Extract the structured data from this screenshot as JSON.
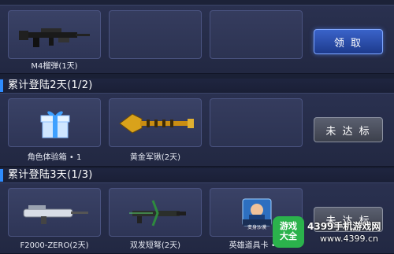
{
  "rows": [
    {
      "header": "",
      "items": [
        {
          "label": "M4榴弹(1天)",
          "icon": "rifle-icon"
        },
        {
          "label": "",
          "icon": ""
        },
        {
          "label": "",
          "icon": ""
        }
      ],
      "button": {
        "label": "领 取",
        "state": "claimable"
      }
    },
    {
      "header": "累计登陆2天(1/2)",
      "items": [
        {
          "label": "角色体验箱 • 1",
          "icon": "gift-box-icon"
        },
        {
          "label": "黄金军锹(2天)",
          "icon": "golden-shovel-icon"
        },
        {
          "label": "",
          "icon": ""
        }
      ],
      "button": {
        "label": "未 达 标",
        "state": "locked"
      }
    },
    {
      "header": "累计登陆3天(1/3)",
      "items": [
        {
          "label": "F2000-ZERO(2天)",
          "icon": "rifle-icon"
        },
        {
          "label": "双发短弩(2天)",
          "icon": "crossbow-icon"
        },
        {
          "label": "英雄道具卡 • 1",
          "icon": "hero-card-icon"
        }
      ],
      "button": {
        "label": "未 达 标",
        "state": "locked"
      }
    }
  ],
  "hero_card_badge": "变身沙漠",
  "watermark": {
    "logo_line1": "游戏",
    "logo_line2": "大全",
    "title": "4399手机游戏网",
    "url": "www.4399.cn"
  },
  "colors": {
    "accent": "#2f8cff",
    "claim_button": "#2d56b8",
    "locked_button": "#4a4e5c",
    "panel": "#262d4a"
  }
}
